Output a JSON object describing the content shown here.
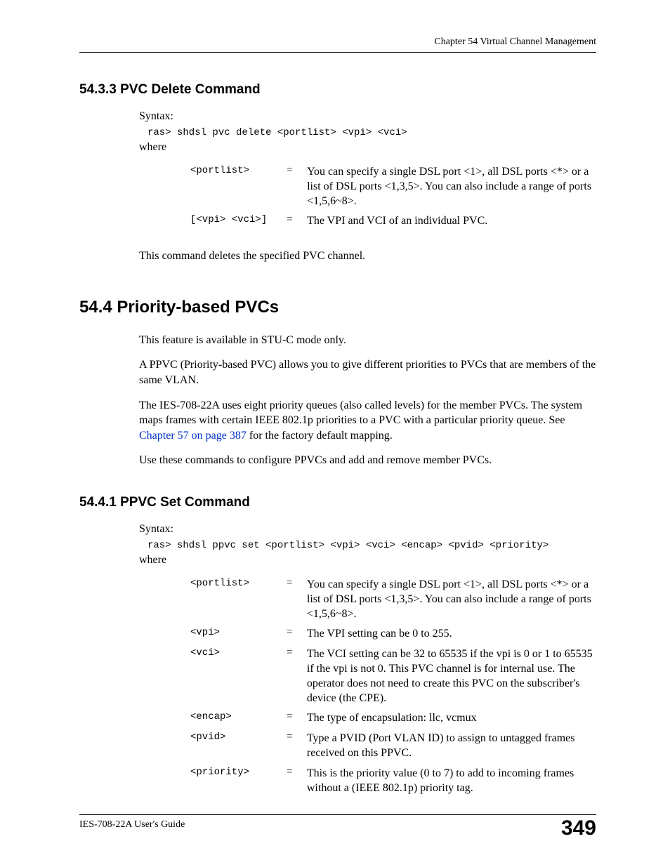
{
  "header": {
    "chapter": "Chapter 54 Virtual Channel Management"
  },
  "sections": {
    "s5433": {
      "heading": "54.3.3  PVC Delete Command",
      "syntax_label": "Syntax:",
      "command": "ras> shdsl pvc delete <portlist> <vpi> <vci>",
      "where_label": "where",
      "params": [
        {
          "name": "<portlist>",
          "desc": "You can specify a single DSL port <1>, all DSL ports <*> or a list of DSL ports <1,3,5>. You can also include a range of ports <1,5,6~8>."
        },
        {
          "name": "[<vpi> <vci>]",
          "desc": "The VPI and VCI of an individual PVC."
        }
      ],
      "trailing": "This command deletes the specified PVC channel."
    },
    "s544": {
      "heading": "54.4  Priority-based PVCs",
      "p1": "This feature is available in STU-C mode only.",
      "p2": "A PPVC (Priority-based PVC) allows you to give different priorities to PVCs that are members of the same VLAN.",
      "p3_pre": "The IES-708-22A uses eight priority queues (also called levels) for the member PVCs. The system maps frames with certain IEEE 802.1p priorities to a PVC with a particular priority queue. See ",
      "p3_link": "Chapter 57 on page 387",
      "p3_post": " for the factory default mapping.",
      "p4": "Use these commands to configure PPVCs and add and remove member PVCs."
    },
    "s5441": {
      "heading": "54.4.1  PPVC Set Command",
      "syntax_label": "Syntax:",
      "command": "ras> shdsl ppvc set <portlist> <vpi> <vci> <encap> <pvid> <priority>",
      "where_label": "where",
      "params": [
        {
          "name": "<portlist>",
          "desc": "You can specify a single DSL port <1>, all DSL ports <*> or a list of DSL ports <1,3,5>. You can also include a range of ports <1,5,6~8>."
        },
        {
          "name": "<vpi>",
          "desc": "The VPI setting can be 0 to 255."
        },
        {
          "name": "<vci>",
          "desc": "The VCI setting can be 32 to 65535 if the vpi is 0 or 1 to 65535 if the vpi is not 0. This PVC channel is for internal use. The operator does not need to create this PVC on the subscriber's device (the CPE)."
        },
        {
          "name": "<encap>",
          "desc": "The type of encapsulation: llc, vcmux"
        },
        {
          "name": "<pvid>",
          "desc": "Type a PVID (Port VLAN ID) to assign to untagged frames received on this PPVC."
        },
        {
          "name": "<priority>",
          "desc": "This is the priority value (0 to 7) to add to incoming frames without a (IEEE 802.1p) priority tag."
        }
      ]
    }
  },
  "footer": {
    "guide": "IES-708-22A User's Guide",
    "page": "349"
  }
}
